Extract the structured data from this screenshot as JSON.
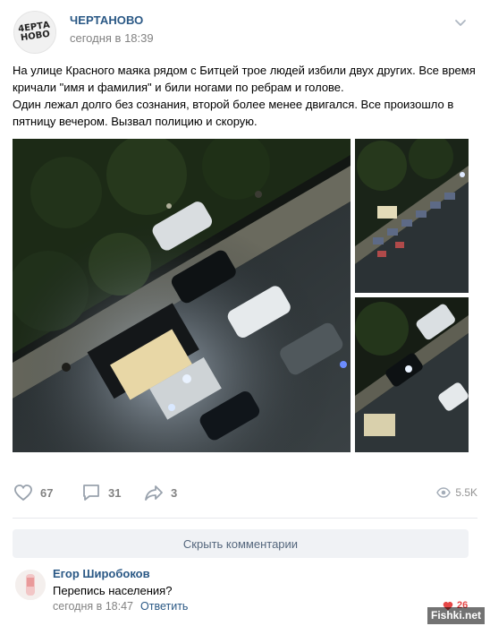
{
  "post": {
    "group_name": "ЧЕРТАНОВО",
    "avatar_logo_text": "4ЕРТА\nНОВО",
    "time": "сегодня в 18:39",
    "text_p1": "На улице Красного маяка рядом с Битцей трое людей избили двух других. Все время кричали \"имя и фамилия\" и били ногами по ребрам и голове.",
    "text_p2": "Один лежал долго без сознания, второй более менее двигался. Все произошло в пятницу вечером. Вызвал полицию и скорую."
  },
  "actions": {
    "likes": "67",
    "comments": "31",
    "shares": "3",
    "views": "5.5K"
  },
  "comments_section": {
    "hide_label": "Скрыть комментарии",
    "comment": {
      "author": "Егор Широбоков",
      "text": "Перепись населения?",
      "time": "сегодня в 18:47",
      "reply_label": "Ответить",
      "likes": "26"
    }
  },
  "watermark": "Fishki.net",
  "colors": {
    "link": "#2a5885",
    "meta": "#828282",
    "like_red": "#e64646",
    "button_bg": "#f0f2f5"
  },
  "icons": {
    "menu": "chevron-down-icon",
    "like": "heart-icon",
    "comment": "comment-bubble-icon",
    "share": "share-arrow-icon",
    "views": "eye-icon"
  }
}
